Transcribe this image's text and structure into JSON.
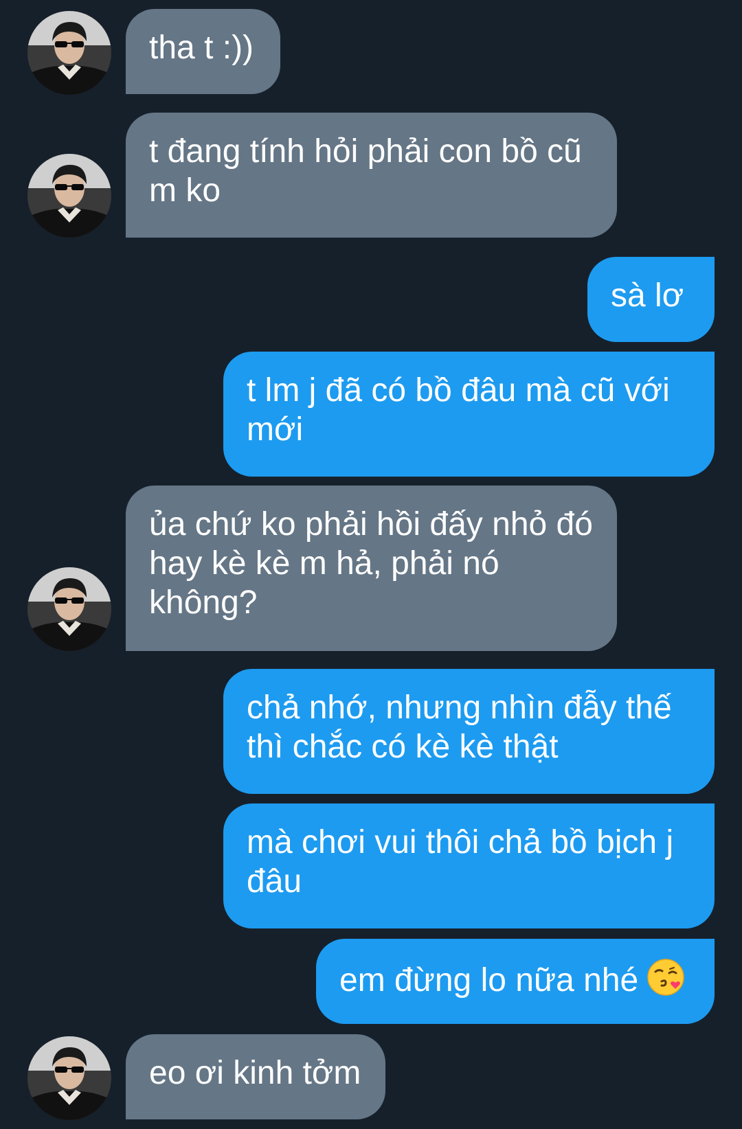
{
  "messages": [
    {
      "direction": "incoming",
      "text": "tha t :))"
    },
    {
      "direction": "incoming",
      "text": "t đang tính hỏi phải con bồ cũ m ko"
    },
    {
      "direction": "outgoing",
      "text": "sà lơ"
    },
    {
      "direction": "outgoing",
      "text": "t lm j đã có bồ đâu mà cũ với mới"
    },
    {
      "direction": "incoming",
      "text": "ủa chứ ko phải hồi đấy nhỏ đó hay kè kè m hả, phải nó không?"
    },
    {
      "direction": "outgoing",
      "text": "chả nhớ, nhưng nhìn đẫy thế thì chắc có kè kè thật"
    },
    {
      "direction": "outgoing",
      "text": "mà chơi vui thôi chả bồ bịch j đâu"
    },
    {
      "direction": "outgoing",
      "text": "em đừng lo nữa nhé",
      "emoji": "face-blowing-a-kiss-icon"
    },
    {
      "direction": "incoming",
      "text": "eo ơi kinh tởm"
    }
  ],
  "colors": {
    "background": "#16202b",
    "incoming_bubble": "#657686",
    "outgoing_bubble": "#1d9bf0",
    "text": "#ffffff"
  }
}
